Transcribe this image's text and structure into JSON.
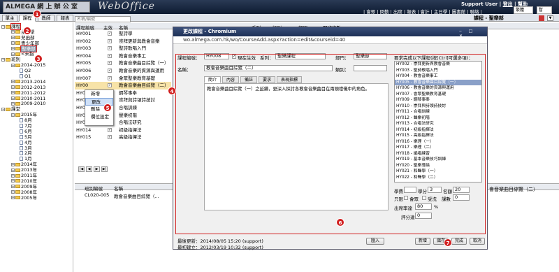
{
  "header": {
    "brand": "ALMEGA 網 上 辦 公 室",
    "product": "WebOffice",
    "user": "Support User",
    "logout": "登出",
    "help": "幫助",
    "links": "| 會眾 | 問勤 | 出席 | 報表 | 會計 | 主日學 | 圖書館 | 聯絡 |",
    "lang": "繁體",
    "list_select": "暫"
  },
  "tabs": [
    "單主",
    "課程",
    "教師",
    "報表"
  ],
  "breadcrumb": "課程 - 聖樂部",
  "sidebar": {
    "items": [
      {
        "label": "課程",
        "kind": "root"
      },
      {
        "label": "主日學",
        "kind": "folder"
      },
      {
        "label": "兒函部",
        "kind": "folder"
      },
      {
        "label": "青少年部",
        "kind": "folder"
      },
      {
        "label": "聖樂部",
        "kind": "folder-selected"
      },
      {
        "label": "<未指",
        "kind": "folder"
      },
      {
        "label": "班別",
        "kind": "root"
      },
      {
        "label": "2014-2015",
        "kind": "folder"
      },
      {
        "label": "Q2",
        "kind": "doc"
      },
      {
        "label": "Q1",
        "kind": "doc"
      },
      {
        "label": "2013-2014",
        "kind": "folder"
      },
      {
        "label": "2012-2013",
        "kind": "folder"
      },
      {
        "label": "2011-2012",
        "kind": "folder"
      },
      {
        "label": "2010-2011",
        "kind": "folder"
      },
      {
        "label": "2009-2010",
        "kind": "folder"
      },
      {
        "label": "課堂",
        "kind": "root"
      },
      {
        "label": "2015年",
        "kind": "folder"
      },
      {
        "label": "8月",
        "kind": "doc"
      },
      {
        "label": "7月",
        "kind": "doc"
      },
      {
        "label": "6月",
        "kind": "doc"
      },
      {
        "label": "5月",
        "kind": "doc"
      },
      {
        "label": "4月",
        "kind": "doc"
      },
      {
        "label": "3月",
        "kind": "doc"
      },
      {
        "label": "2月",
        "kind": "doc"
      },
      {
        "label": "1月",
        "kind": "doc"
      },
      {
        "label": "2014年",
        "kind": "folder"
      },
      {
        "label": "2013年",
        "kind": "folder"
      },
      {
        "label": "2011年",
        "kind": "folder"
      },
      {
        "label": "2010年",
        "kind": "folder"
      },
      {
        "label": "2009年",
        "kind": "folder"
      },
      {
        "label": "2008年",
        "kind": "folder"
      },
      {
        "label": "2005年",
        "kind": "folder"
      }
    ]
  },
  "grid": {
    "search_placeholder": "名稱/編號",
    "columns": [
      "課程編號",
      "主效",
      "名稱",
      "系列",
      "類別",
      "部門",
      "開班次數"
    ],
    "rows": [
      {
        "id": "HY001",
        "name": "聖詩學"
      },
      {
        "id": "HY002",
        "name": "崇拜更新與教會音樂"
      },
      {
        "id": "HY003",
        "name": "聖詩歌唱入門"
      },
      {
        "id": "HY004",
        "name": "教會音樂事工"
      },
      {
        "id": "HY005",
        "name": "教會音樂曲目綜覽（一）"
      },
      {
        "id": "HY006",
        "name": "教會音樂的資源與運用"
      },
      {
        "id": "HY007",
        "name": "會眾聖樂教育基礎"
      },
      {
        "id": "HY00",
        "name": "教會音樂曲目綜覽（二）"
      },
      {
        "id": "HY0",
        "name": "鋼琴事奉"
      },
      {
        "id": "HY0",
        "name": "崇拜與詩領詩技討"
      },
      {
        "id": "HY0",
        "name": "合唱訓練"
      },
      {
        "id": "HY0",
        "name": "聲樂初階"
      },
      {
        "id": "HY013",
        "name": "合唱法研究"
      },
      {
        "id": "HY014",
        "name": "初級指揮法"
      },
      {
        "id": "HY015",
        "name": "高級指揮法"
      }
    ],
    "bottom_columns": [
      "班別編號",
      "名稱"
    ],
    "bottom_row": {
      "id": "CL020-005",
      "name": "教會音樂曲目綜覽（..."
    },
    "right_caption": "會音樂曲目綜覽（二）"
  },
  "context_menu": [
    "新增",
    "更改",
    "刪除",
    "欄位設定"
  ],
  "dialog": {
    "title": "更改課程 - Chromium",
    "url": "wo.almega.com.hk/wo/CourseAdd.aspx?action=edit&courseid=40",
    "course_code_label": "課程編號：",
    "course_code": "HY008",
    "active_label": "現在生效",
    "series_label": "系列：",
    "series_value": "聖樂課程",
    "dept_label": "部門：",
    "dept_value": "聖樂部",
    "name_label": "名稱：",
    "name_value": "教會音樂曲目綜覽（二）",
    "category_label": "類別：",
    "prereq_label": "要求完成以下課程(按[Ctrl]可選多項)：",
    "inner_tabs": [
      "簡介",
      "內容",
      "備註",
      "要求",
      "表現指標"
    ],
    "description": "教會音樂曲目綜覽（一）之延續，更深入探討各教會音樂曲目在兩頭禮儀中的角色。",
    "prereq_list": [
      "HY002 - 崇拜更新與教會音樂",
      "HY003 - 聖詩歌唱入門",
      "HY004 - 教會音樂事工",
      "HY005 - 教會音樂曲目綜覽（一）",
      "HY006 - 教會音樂的資源與運用",
      "HY007 - 會眾聖樂教育基礎",
      "HY009 - 鋼琴事奉",
      "HY010 - 崇拜與詩領詩技討",
      "HY011 - 合唱訓練",
      "HY012 - 聲樂初階",
      "HY013 - 合唱法研究",
      "HY014 - 初級指揮法",
      "HY015 - 高級指揮法",
      "HY016 - 樂理（一）",
      "HY017 - 樂理（二）",
      "HY018 - 編唱練習",
      "HY019 - 基本音樂技巧訓練",
      "HY020 - 聖樂導論",
      "HY021 - 和聲學（一）",
      "HY022 - 和聲學（二）"
    ],
    "selected_prereq_index": 3,
    "fees_label": "學費",
    "credits_label": "學分",
    "credits": "3",
    "seats_label": "名額",
    "seats": "20",
    "filter_label": "只限",
    "member_label": "會眾",
    "baptized_label": "受洗",
    "sessions_label": "課數",
    "sessions": "0",
    "attendance_label": "出席率達",
    "attendance": "80",
    "percent": "%",
    "score_label": "評分達",
    "score": "0",
    "updated": "最後更新：2014/08/05 15:20 (support)",
    "created": "最初建立：2012/03/19 10:32 (support)",
    "buttons": [
      "匯入",
      "新增",
      "儲存",
      "完成",
      "取消"
    ]
  },
  "callouts": [
    "1",
    "2",
    "3",
    "4",
    "5",
    "6",
    "7"
  ],
  "colors": {
    "callout": "#d11f1f",
    "titlebar": "#1f3157",
    "highlight": "#8aa0c8"
  }
}
